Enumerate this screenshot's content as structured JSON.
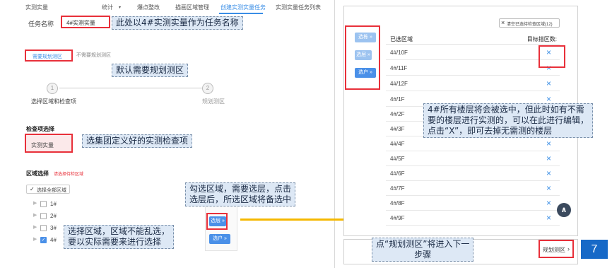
{
  "nav": {
    "items": [
      "实测实量",
      "统计",
      "爆点整改",
      "描画区域管理",
      "创建实测实量任务",
      "实测实量任务列表"
    ]
  },
  "form": {
    "task_name_label": "任务名称",
    "task_name_value": "4#实测实量",
    "tab_need": "需要规划测区",
    "tab_no_need": "不需要规划测区",
    "step1_num": "1",
    "step1_label": "选择区域和检查项",
    "step2_num": "2",
    "step2_label": "规划测区",
    "check_label": "检查项选择",
    "check_value": "实测实量",
    "area_label": "区域选择",
    "area_hint": "请选择待检区域",
    "select_all": "选择全部区域",
    "tree": [
      "1#",
      "2#",
      "3#",
      "4#"
    ],
    "btn_select_floor": "选层",
    "btn_select_unit": "选户"
  },
  "callouts": {
    "task_name": "此处以4#实测实量作为任务名称",
    "default_plan": "默认需要规划测区",
    "check_items": "选集团定义好的实测检查项",
    "select_area_line1": "选择区域，区域不能乱选，",
    "select_area_line2": "要以实际需要来进行选择",
    "check_floors_line1": "勾选区域，需要选层，点击",
    "check_floors_line2": "选层后，所选区域将备选中",
    "floors_line1": "4#所有楼层将会被选中，但此时如有不需",
    "floors_line2": "要的楼层进行实测的，可以在此进行编辑，",
    "floors_line3": "点击“X”，即可去掉无需测的楼层",
    "next_line1": "点“规划测区”将进入下一",
    "next_line2": "步骤"
  },
  "right": {
    "clear_btn": "清空已选待检查区域(12)",
    "side_buttons": [
      "选栋",
      "选层",
      "选户"
    ],
    "col_selected": "已选区域",
    "col_target": "目标描区数:",
    "rows": [
      "4#/10F",
      "4#/11F",
      "4#/12F",
      "4#/1F",
      "4#/2F",
      "4#/3F",
      "4#/4F",
      "4#/5F",
      "4#/6F",
      "4#/7F",
      "4#/8F",
      "4#/9F"
    ],
    "remove_glyph": "×",
    "plan_btn": "规划测区",
    "page_number": "7"
  }
}
